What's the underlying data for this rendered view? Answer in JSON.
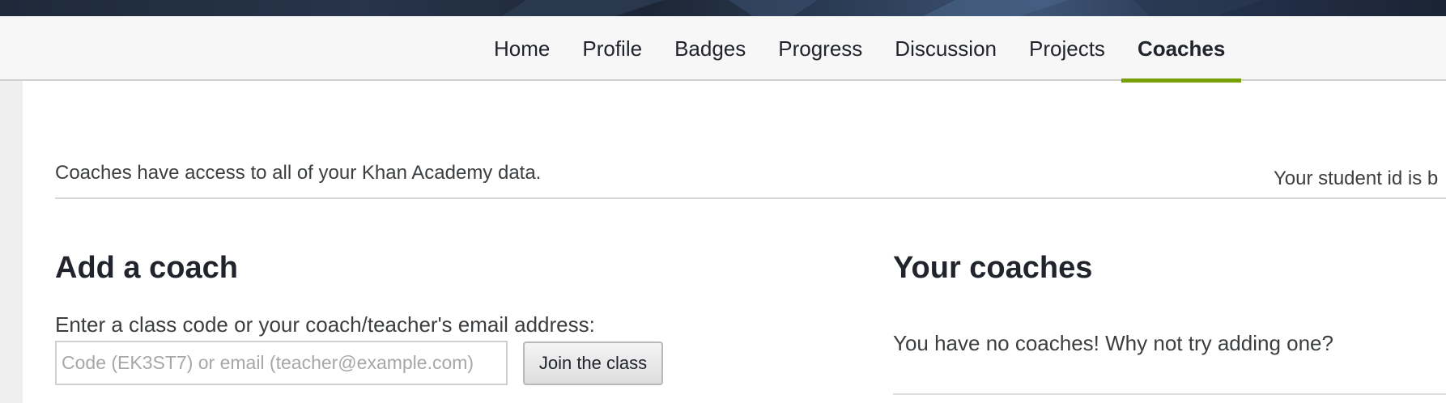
{
  "nav": {
    "items": [
      {
        "label": "Home",
        "active": false
      },
      {
        "label": "Profile",
        "active": false
      },
      {
        "label": "Badges",
        "active": false
      },
      {
        "label": "Progress",
        "active": false
      },
      {
        "label": "Discussion",
        "active": false
      },
      {
        "label": "Projects",
        "active": false
      },
      {
        "label": "Coaches",
        "active": true
      }
    ],
    "active_color": "#76a005"
  },
  "info": {
    "access_text": "Coaches have access to all of your Khan Academy data.",
    "student_id_text": "Your student id is b"
  },
  "add_coach": {
    "heading": "Add a coach",
    "prompt": "Enter a class code or your coach/teacher's email address:",
    "input_value": "",
    "input_placeholder": "Code (EK3ST7) or email (teacher@example.com)",
    "button_label": "Join the class"
  },
  "your_coaches": {
    "heading": "Your coaches",
    "empty_text": "You have no coaches! Why not try adding one?"
  }
}
